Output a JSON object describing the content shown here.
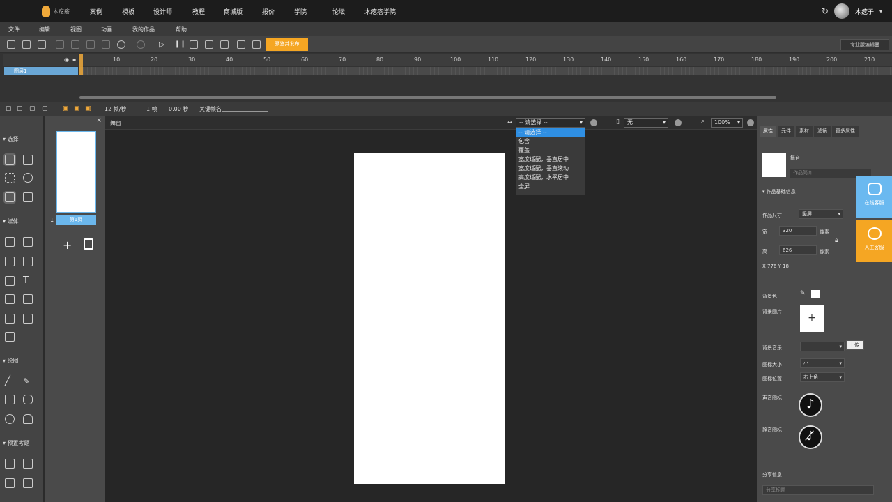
{
  "topnav": {
    "logo_text": "木疙瘩",
    "items": [
      "案例",
      "模板",
      "设计师",
      "教程",
      "商城版",
      "报价",
      "学院",
      "论坛",
      "木疙瘩学院"
    ],
    "user_name": "木疙子"
  },
  "menubar": {
    "items": [
      "文件",
      "编辑",
      "视图",
      "动画",
      "我的作品",
      "帮助"
    ]
  },
  "toolbar": {
    "publish_label": "预览并发布",
    "pro_editor_label": "专业版编辑器"
  },
  "timeline": {
    "ticks": [
      "10",
      "20",
      "30",
      "40",
      "50",
      "60",
      "70",
      "80",
      "90",
      "100",
      "110",
      "120",
      "130",
      "140",
      "150",
      "160",
      "170",
      "180",
      "190",
      "200",
      "210"
    ],
    "layer_name": "图层1"
  },
  "timeline_status": {
    "fps": "12 帧/秒",
    "frame": "1 帧",
    "time": "0.00 秒",
    "keyframe_label": "关键帧名"
  },
  "left_tools": {
    "sections": [
      "选择",
      "媒体",
      "绘图",
      "预置考题"
    ]
  },
  "pages": {
    "page_label": "第1页",
    "page_number": "1"
  },
  "stage_bar": {
    "tab_label": "舞台",
    "adapt_select": "-- 请选择 --",
    "device_select": "无",
    "zoom_select": "100%"
  },
  "dropdown": {
    "options": [
      "-- 请选择 --",
      "包含",
      "覆盖",
      "宽度适配，垂直居中",
      "宽度适配，垂直滚动",
      "高度适配，水平居中",
      "全屏"
    ],
    "highlighted": 0
  },
  "right_panel": {
    "tabs": [
      "属性",
      "元件",
      "素材",
      "滤镜",
      "更多属性"
    ],
    "active_tab": 0,
    "stage_name": "舞台",
    "stage_desc_placeholder": "作品简介",
    "section_title": "作品基础信息",
    "size_label": "作品尺寸",
    "size_value": "竖屏",
    "width_label": "宽",
    "width_value": "320",
    "height_label": "高",
    "height_value": "626",
    "unit": "像素",
    "coords": "X 776   Y 18",
    "bg_color_label": "背景色",
    "bg_image_label": "背景图片",
    "bg_music_label": "背景音乐",
    "music_icon_size_label": "图标大小",
    "music_icon_size_value": "小",
    "music_icon_pos_label": "图标位置",
    "music_icon_pos_value": "右上角",
    "play_icon_label": "声音图标",
    "mute_icon_label": "静音图标",
    "share_label": "分享信息",
    "share_title_placeholder": "分享标题",
    "upload_label": "上传"
  },
  "float_buttons": {
    "first": "在线客服",
    "second": "人工客服"
  },
  "colors": {
    "accent_orange": "#f5a623",
    "selection_blue": "#2f8fe3",
    "page_blue": "#6bb7ec"
  }
}
